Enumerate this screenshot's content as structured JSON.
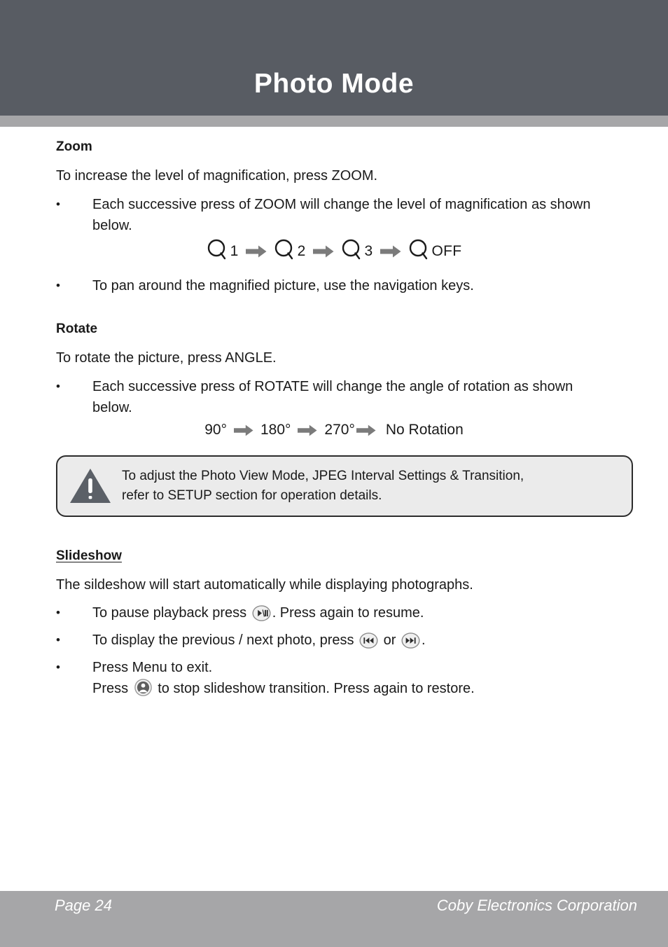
{
  "header": {
    "title": "Photo Mode",
    "band_color": "#585c63",
    "accent_color": "#a6a6a8"
  },
  "sections": {
    "zoom": {
      "heading": "Zoom",
      "intro": "To increase the level of magnification, press ZOOM.",
      "bullets": [
        "Each successive press of ZOOM will change the level of magnification as shown below.",
        "To pan around the magnified picture, use the navigation keys."
      ],
      "bullet_marker": "•",
      "sequence": [
        {
          "icon": "magnifier-icon",
          "label": "1"
        },
        {
          "icon": "magnifier-icon",
          "label": "2"
        },
        {
          "icon": "magnifier-icon",
          "label": "3"
        },
        {
          "icon": "magnifier-icon",
          "label": "OFF"
        }
      ],
      "arrow_icon": "right-arrow-icon"
    },
    "rotate": {
      "heading": "Rotate",
      "intro": "To rotate the picture, press ANGLE.",
      "bullets": [
        "Each successive press of ROTATE will change the angle of rotation as shown below."
      ],
      "sequence": [
        "90°",
        "180°",
        "270°",
        "No Rotation"
      ]
    },
    "note": {
      "icon": "warning-triangle-icon",
      "line1": "To adjust the Photo View Mode, JPEG Interval Settings & Transition,",
      "line2": "refer to SETUP section for operation details.",
      "background_color": "#ebebeb",
      "border_color": "#2c2c2c"
    },
    "slideshow": {
      "heading": "Slideshow",
      "intro": "The sildeshow will start automatically while displaying photographs.",
      "bullets": [
        {
          "parts": [
            {
              "type": "text",
              "value": "To pause playback press "
            },
            {
              "type": "icon",
              "value": "play-pause-button-icon"
            },
            {
              "type": "text",
              "value": ". Press again to resume."
            }
          ]
        },
        {
          "parts": [
            {
              "type": "text",
              "value": "To display the previous / next photo, press "
            },
            {
              "type": "icon",
              "value": "previous-track-button-icon"
            },
            {
              "type": "text",
              "value": " or "
            },
            {
              "type": "icon",
              "value": "next-track-button-icon"
            },
            {
              "type": "text",
              "value": "."
            }
          ]
        },
        {
          "parts": [
            {
              "type": "text",
              "value": "Press Menu to exit."
            },
            {
              "type": "break",
              "value": ""
            },
            {
              "type": "text",
              "value": "Press "
            },
            {
              "type": "icon",
              "value": "display-button-icon"
            },
            {
              "type": "text",
              "value": " to stop slideshow transition. Press again to restore."
            }
          ]
        }
      ]
    }
  },
  "labels": {
    "zoom_heading": "Zoom",
    "zoom_intro": "To increase the level of magnification, press ZOOM.",
    "zoom_b1": "Each successive press of ZOOM will change the level of magnification as shown below.",
    "zoom_b2": "To pan around the magnified picture, use the navigation keys.",
    "rotate_heading": "Rotate",
    "rotate_intro": "To rotate the picture, press ANGLE.",
    "rotate_b1": "Each successive press of ROTATE will change the angle of rotation as shown below.",
    "slideshow_heading": "Slideshow",
    "slideshow_intro": "The sildeshow will start automatically while displaying photographs.",
    "note_line1": "To adjust the Photo View Mode, JPEG Interval Settings & Transition,",
    "note_line2": "refer to SETUP section for operation details.",
    "bullet": "•",
    "seq_zoom_1": "1",
    "seq_zoom_2": "2",
    "seq_zoom_3": "3",
    "seq_zoom_4": "OFF",
    "seq_rot_1": "90°",
    "seq_rot_2": "180°",
    "seq_rot_3": "270°",
    "seq_rot_4": "No Rotation",
    "ss_b1_a": "To pause playback press ",
    "ss_b1_b": ". Press again to resume.",
    "ss_b2_a": "To display the previous / next photo, press ",
    "ss_b2_b": " or ",
    "ss_b2_c": ".",
    "ss_b3_a": "Press Menu to exit.",
    "ss_b3_b": "Press ",
    "ss_b3_c": " to stop slideshow transition. Press again to restore."
  },
  "footer": {
    "page_label": "Page 24",
    "company": "Coby Electronics Corporation",
    "band_color": "#a6a6a8"
  }
}
